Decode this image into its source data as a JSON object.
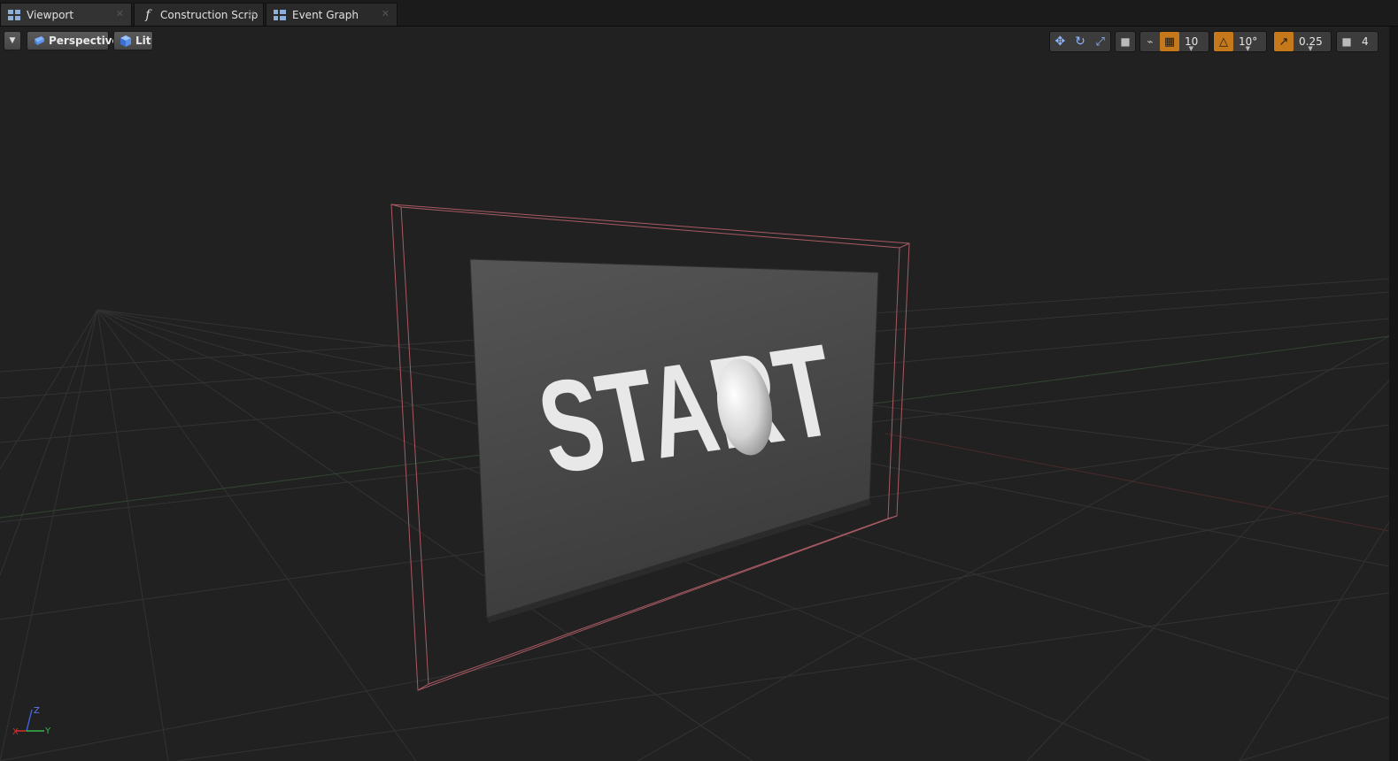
{
  "tabs": [
    {
      "label": "Viewport",
      "icon": "viewport-grid-icon",
      "active": true
    },
    {
      "label": "Construction Scrip",
      "icon": "function-f-icon",
      "active": false
    },
    {
      "label": "Event Graph",
      "icon": "event-graph-icon",
      "active": false
    }
  ],
  "toolbar": {
    "dropdown_icon": "chevron-down-icon",
    "perspective_label": "Perspective",
    "lit_label": "Lit",
    "grid_snap_value": "10",
    "rotation_snap_value": "10°",
    "scale_snap_value": "0.25",
    "camera_speed_value": "4"
  },
  "scene": {
    "panel_text": "START"
  },
  "axis": {
    "z_label": "Z",
    "y_label": "Y",
    "x_label": "X"
  },
  "colors": {
    "accent_orange": "#c5791a",
    "viewport_bg": "#212121",
    "bounds_outline": "#a85a63",
    "grid_line": "#3a3a3a"
  }
}
